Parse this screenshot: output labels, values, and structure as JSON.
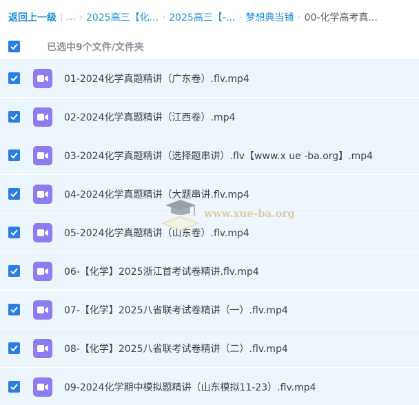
{
  "breadcrumb": {
    "back_label": "返回上一级",
    "ellipsis": "...",
    "items": [
      "2025高三【化...",
      "2025高三【-...",
      "梦想典当铺"
    ],
    "current": "00-化学高考真..."
  },
  "selection": {
    "label": "已选中9个文件/文件夹"
  },
  "files": [
    {
      "name": "01-2024化学真题精讲（广东卷）.flv.mp4",
      "icon": "video-icon"
    },
    {
      "name": "02-2024化学真题精讲（江西卷）.mp4",
      "icon": "video-icon"
    },
    {
      "name": "03-2024化学真题精讲（选择题串讲）.flv【www.x ue -ba.org】.mp4",
      "icon": "video-icon"
    },
    {
      "name": "04-2024化学真题精讲（大题串讲.flv.mp4",
      "icon": "video-icon"
    },
    {
      "name": "05-2024化学真题精讲（山东卷）.flv.mp4",
      "icon": "video-icon"
    },
    {
      "name": "06-【化学】2025浙江首考试卷精讲.flv.mp4",
      "icon": "video-icon"
    },
    {
      "name": "07-【化学】2025八省联考试卷精讲（一）.flv.mp4",
      "icon": "video-icon"
    },
    {
      "name": "08-【化学】2025八省联考试卷精讲（二）.flv.mp4",
      "icon": "video-icon"
    },
    {
      "name": "09-2024化学期中模拟题精讲（山东模拟11-23）.flv.mp4",
      "icon": "video-icon"
    }
  ],
  "watermark": {
    "text": "www.xue-ba.org"
  },
  "colors": {
    "accent": "#2b7fe0",
    "link": "#1e8fd6",
    "row_bg": "#eef6fd",
    "video_icon": "#8e7cf0"
  }
}
